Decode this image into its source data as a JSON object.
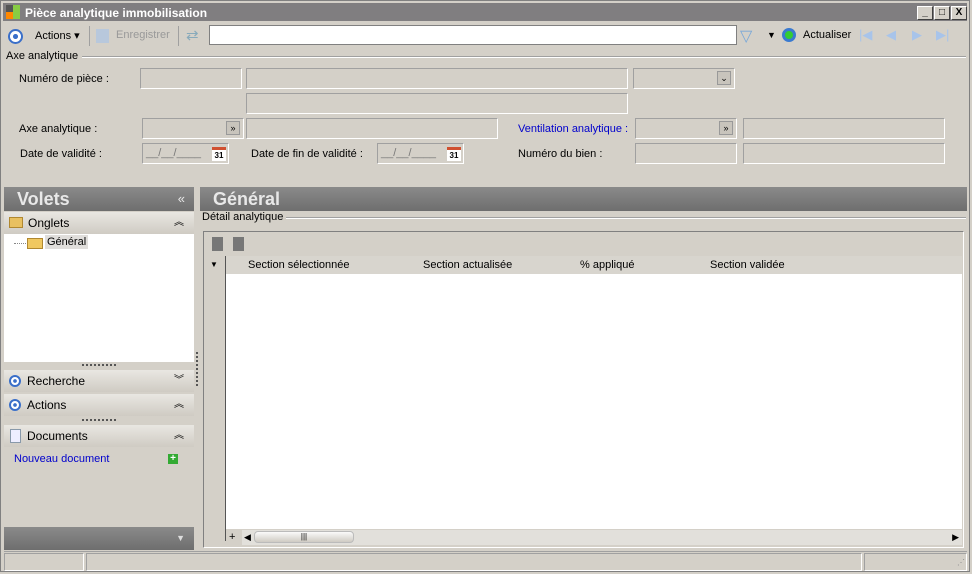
{
  "window": {
    "title": "Pièce analytique immobilisation",
    "min": "_",
    "max": "□",
    "close": "X"
  },
  "toolbar": {
    "actions": "Actions",
    "save": "Enregistrer",
    "search_value": "",
    "refresh": "Actualiser"
  },
  "form": {
    "group_label": "Axe analytique",
    "numero_piece": "Numéro de pièce :",
    "axe_analytique": "Axe analytique :",
    "date_validite": "Date de validité :",
    "date_fin_validite": "Date de fin de validité :",
    "ventilation": "Ventilation analytique :",
    "numero_bien": "Numéro du bien :",
    "date_placeholder": "__/__/____",
    "cal_day": "31"
  },
  "sidebar": {
    "title": "Volets",
    "collapse": "«",
    "onglets": "Onglets",
    "tree_item": "Général",
    "recherche": "Recherche",
    "actions": "Actions",
    "documents": "Documents",
    "new_doc": "Nouveau document"
  },
  "main": {
    "title": "Général",
    "group_label": "Détail analytique",
    "columns": [
      "Section sélectionnée",
      "Section actualisée",
      "% appliqué",
      "Section validée"
    ],
    "add": "+"
  },
  "colors": {
    "link": "#0000cc",
    "header": "#7a7a7a"
  }
}
